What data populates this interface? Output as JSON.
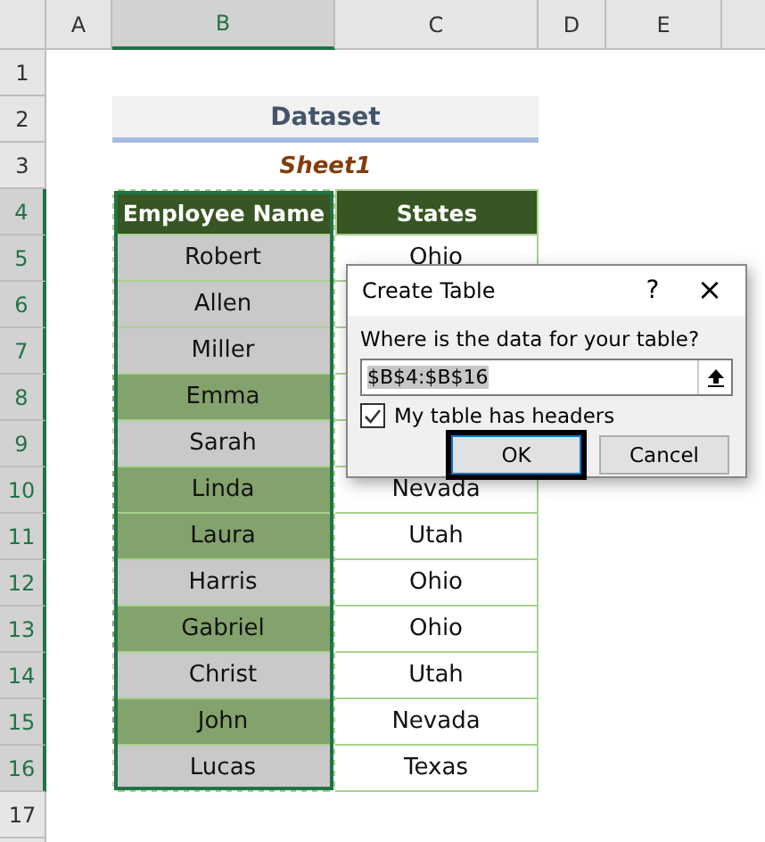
{
  "columns": [
    {
      "label": "A",
      "selected": false
    },
    {
      "label": "B",
      "selected": true
    },
    {
      "label": "C",
      "selected": false
    },
    {
      "label": "D",
      "selected": false
    },
    {
      "label": "E",
      "selected": false
    }
  ],
  "row_numbers": [
    {
      "label": "1",
      "selected": false
    },
    {
      "label": "2",
      "selected": false
    },
    {
      "label": "3",
      "selected": false
    },
    {
      "label": "4",
      "selected": true
    },
    {
      "label": "5",
      "selected": true
    },
    {
      "label": "6",
      "selected": true
    },
    {
      "label": "7",
      "selected": true
    },
    {
      "label": "8",
      "selected": true
    },
    {
      "label": "9",
      "selected": true
    },
    {
      "label": "10",
      "selected": true
    },
    {
      "label": "11",
      "selected": true
    },
    {
      "label": "12",
      "selected": true
    },
    {
      "label": "13",
      "selected": true
    },
    {
      "label": "14",
      "selected": true
    },
    {
      "label": "15",
      "selected": true
    },
    {
      "label": "16",
      "selected": true
    },
    {
      "label": "17",
      "selected": false
    }
  ],
  "title": "Dataset",
  "subtitle": "Sheet1",
  "table": {
    "headers": [
      "Employee Name",
      "States"
    ],
    "rows": [
      {
        "name": "Robert",
        "state": "Ohio",
        "color": "#c9c9c9"
      },
      {
        "name": "Allen",
        "color": "#c9c9c9"
      },
      {
        "name": "Miller",
        "color": "#c9c9c9"
      },
      {
        "name": "Emma",
        "color": "#84a36c"
      },
      {
        "name": "Sarah",
        "color": "#c9c9c9"
      },
      {
        "name": "Linda",
        "state": "Nevada",
        "color": "#84a36c"
      },
      {
        "name": "Laura",
        "state": "Utah",
        "color": "#84a36c"
      },
      {
        "name": "Harris",
        "state": "Ohio",
        "color": "#c9c9c9"
      },
      {
        "name": "Gabriel",
        "state": "Ohio",
        "color": "#84a36c"
      },
      {
        "name": "Christ",
        "state": "Utah",
        "color": "#c9c9c9"
      },
      {
        "name": "John",
        "state": "Nevada",
        "color": "#84a36c"
      },
      {
        "name": "Lucas",
        "state": "Texas",
        "color": "#c9c9c9"
      }
    ]
  },
  "dialog": {
    "title": "Create Table",
    "help": "?",
    "close": "×",
    "prompt": "Where is the data for your table?",
    "range": "$B$4:$B$16",
    "has_headers": {
      "label": "My table has headers",
      "checked": true
    },
    "buttons": [
      {
        "label": "OK",
        "selected": true
      },
      {
        "label": "Cancel",
        "selected": false
      }
    ]
  }
}
